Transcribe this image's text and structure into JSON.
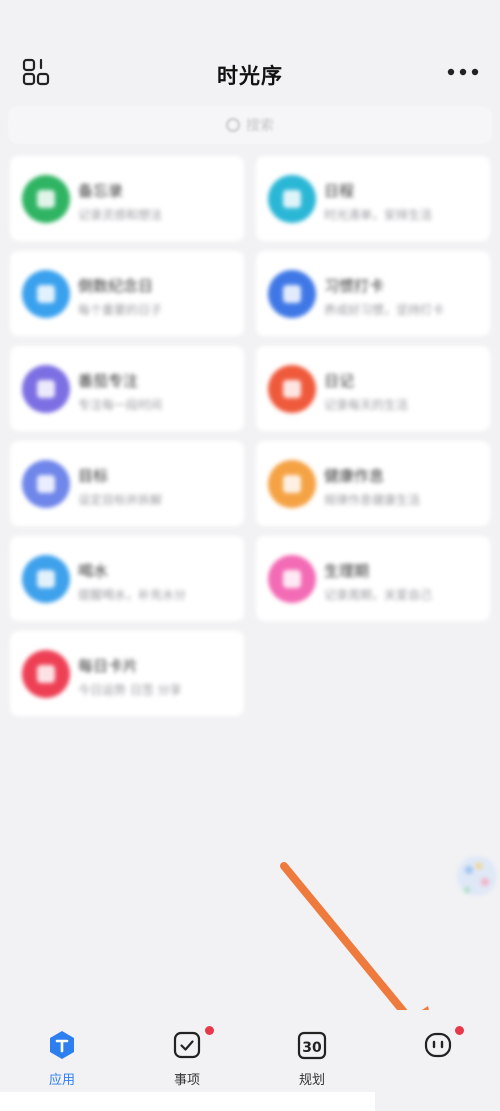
{
  "header": {
    "title": "时光序",
    "scan_icon": "scan-icon",
    "more_icon": "more-icon"
  },
  "search": {
    "placeholder": "搜索",
    "icon": "search-icon"
  },
  "apps": [
    {
      "name": "备忘录",
      "desc": "记录灵感和想法",
      "color": "#2fb463",
      "icon": "memo-icon"
    },
    {
      "name": "日程",
      "desc": "时光清单，安排生活",
      "color": "#2ab7d6",
      "icon": "schedule-icon"
    },
    {
      "name": "倒数纪念日",
      "desc": "每个重要的日子",
      "color": "#3aa1ee",
      "icon": "countdown-icon"
    },
    {
      "name": "习惯打卡",
      "desc": "养成好习惯，坚持打卡",
      "color": "#3f78e6",
      "icon": "habit-icon"
    },
    {
      "name": "番茄专注",
      "desc": "专注每一段时间",
      "color": "#7c6fe3",
      "icon": "pomodoro-icon"
    },
    {
      "name": "日记",
      "desc": "记录每天的生活",
      "color": "#ef5a3c",
      "icon": "diary-icon"
    },
    {
      "name": "目标",
      "desc": "设定目标并拆解",
      "color": "#6f86ea",
      "icon": "goal-icon"
    },
    {
      "name": "健康作息",
      "desc": "规律作息健康生活",
      "color": "#f5a244",
      "icon": "health-icon"
    },
    {
      "name": "喝水",
      "desc": "提醒喝水，补充水分",
      "color": "#3ea1ec",
      "icon": "water-icon"
    },
    {
      "name": "生理期",
      "desc": "记录周期，关爱自己",
      "color": "#f36bb5",
      "icon": "period-icon"
    },
    {
      "name": "每日卡片",
      "desc": "今日运势 日签 分享",
      "color": "#ee4055",
      "icon": "card-icon"
    }
  ],
  "tabs": [
    {
      "label": "应用",
      "icon": "apps-hexagon-icon",
      "active": true,
      "badge": false
    },
    {
      "label": "事项",
      "icon": "check-square-icon",
      "active": false,
      "badge": true
    },
    {
      "label": "规划",
      "icon": "calendar-30-icon",
      "active": false,
      "badge": false
    },
    {
      "label": "",
      "icon": "profile-face-icon",
      "active": false,
      "badge": true
    }
  ],
  "colors": {
    "accent": "#2d7ff0",
    "badge": "#e8394a",
    "annotation_arrow": "#ef7a3d"
  }
}
